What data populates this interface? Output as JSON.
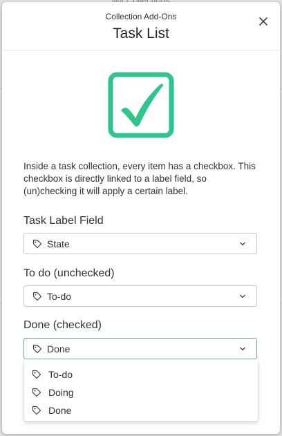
{
  "background": {
    "header_text": "My Collections"
  },
  "modal": {
    "subtitle": "Collection Add-Ons",
    "title": "Task List",
    "close_icon": "close-icon",
    "hero_icon": "checkbox-checked-icon",
    "description": "Inside a task collection, every item has a checkbox. This checkbox is directly linked to a label field, so (un)checking it will apply a certain label."
  },
  "fields": [
    {
      "label": "Task Label Field",
      "value": "State"
    },
    {
      "label": "To do (unchecked)",
      "value": "To-do"
    },
    {
      "label": "Done (checked)",
      "value": "Done"
    }
  ],
  "dropdown": {
    "options": [
      "To-do",
      "Doing",
      "Done"
    ]
  },
  "colors": {
    "accent_green": "#2fc58c",
    "focus_border": "#6c9ac4",
    "text": "#2f3337"
  }
}
